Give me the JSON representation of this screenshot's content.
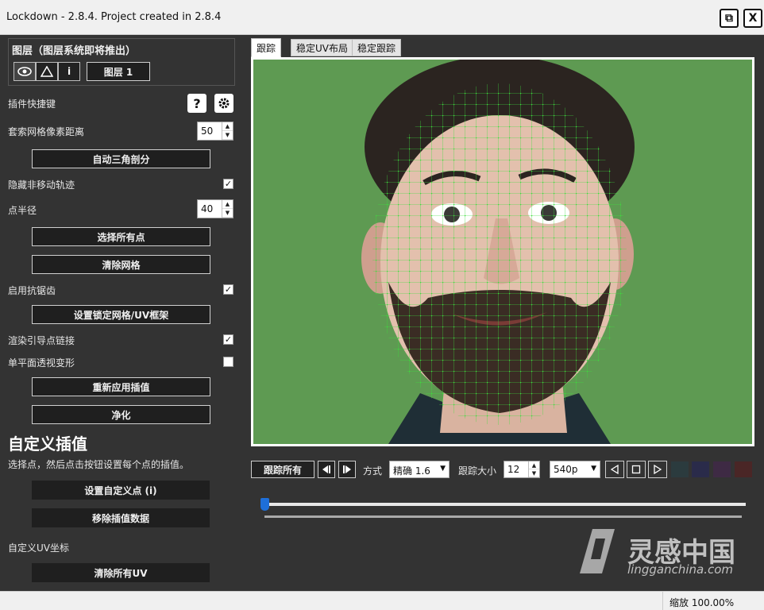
{
  "window": {
    "title": "Lockdown - 2.8.4. Project created in 2.8.4",
    "restore_label": "⧉",
    "close_label": "X"
  },
  "layers": {
    "header": "图层（图层系统即将推出）",
    "info_label": "i",
    "layer_button": "图层 1"
  },
  "left": {
    "shortcut_label": "插件快捷键",
    "help_label": "?",
    "lasso_label": "套索网格像素距离",
    "lasso_value": "50",
    "auto_triangulate": "自动三角剖分",
    "hide_static_label": "隐藏非移动轨迹",
    "hide_static_checked": true,
    "point_radius_label": "点半径",
    "point_radius_value": "40",
    "select_all_points": "选择所有点",
    "clear_mesh": "清除网格",
    "antialias_label": "启用抗锯齿",
    "antialias_checked": true,
    "set_lock_mesh": "设置锁定网格/UV框架",
    "render_guide_label": "渲染引导点链接",
    "render_guide_checked": true,
    "planar_label": "单平面透视变形",
    "planar_checked": false,
    "reapply": "重新应用插值",
    "purify": "净化",
    "custom_heading": "自定义插值",
    "custom_desc": "选择点，然后点击按钮设置每个点的插值。",
    "set_custom_points": "设置自定义点 (i)",
    "remove_interp": "移除插值数据",
    "custom_uv_label": "自定义UV坐标",
    "clear_uv": "清除所有UV"
  },
  "tabs": [
    {
      "label": "跟踪",
      "active": true
    },
    {
      "label": "稳定UV布局",
      "active": false
    },
    {
      "label": "稳定跟踪",
      "active": false
    }
  ],
  "controls": {
    "track_all": "跟踪所有",
    "mode_label": "方式",
    "mode_value": "精确 1.6",
    "track_size_label": "跟踪大小",
    "track_size_value": "12",
    "resolution_value": "540p",
    "timeline_position": 0
  },
  "status": {
    "zoom": "缩放 100.00%"
  },
  "watermark": {
    "name": "灵感中国",
    "url": "lingganchina.com"
  },
  "colors": {
    "panel_bg": "#333333",
    "green_screen": "#5e9a52",
    "mesh_green": "#3cdc3c",
    "slider_blue": "#1e6fd9"
  }
}
